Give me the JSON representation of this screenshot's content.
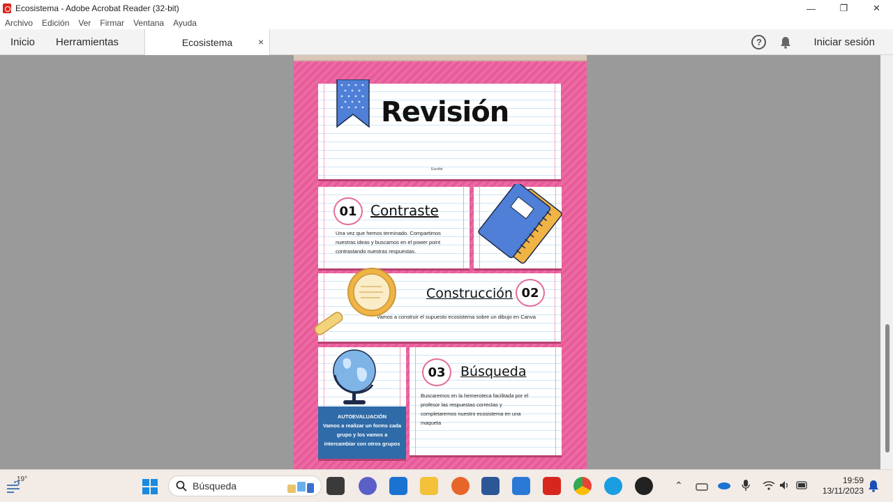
{
  "window": {
    "title": "Ecosistema - Adobe Acrobat Reader (32-bit)"
  },
  "menu": [
    "Archivo",
    "Edición",
    "Ver",
    "Firmar",
    "Ventana",
    "Ayuda"
  ],
  "tabs": {
    "home": "Inicio",
    "tools": "Herramientas",
    "document": "Ecosistema",
    "close": "×",
    "signin": "Iniciar sesión",
    "help": "?"
  },
  "document": {
    "title": "Revisión",
    "subtitle_small": "Escribir",
    "section1": {
      "number": "01",
      "heading": "Contraste",
      "text": "Una vez que hemos terminado. Compartimos nuestras ideas y buscamos en el power point contrastando nuestras respuestas."
    },
    "section2": {
      "number": "02",
      "heading": "Construcción",
      "text": "Vamos a construir el supuesto ecosistema sobre un dibujo en Canva"
    },
    "section3": {
      "number": "03",
      "heading": "Búsqueda",
      "text": "Buscaremos en la hemeroteca facilitada por el profesor las respuestas correctas y completaremos nuestro ecosistema en una maqueta"
    },
    "autoeval": {
      "title": "AUTOEVALUACIÓN",
      "text": "Vamos a realizar un forms cada grupo y los vamos a intercambiar con otros grupos"
    }
  },
  "taskbar": {
    "search_placeholder": "Búsqueda",
    "weather": "19°",
    "time": "19:59",
    "date": "13/11/2023"
  },
  "colors": {
    "page_pink": "#ec6ba5",
    "accent_blue": "#2f6ba8",
    "acrobat_red": "#d7261e"
  }
}
